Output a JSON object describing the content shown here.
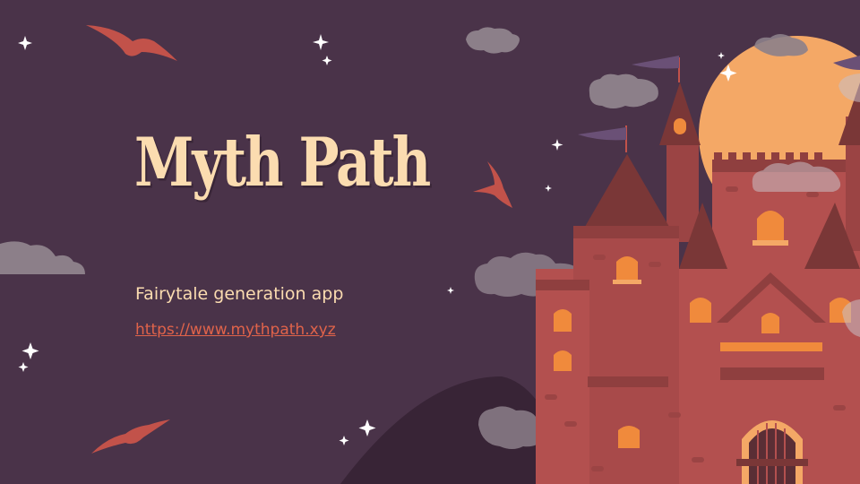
{
  "slide": {
    "title": "Myth Path",
    "subtitle": "Fairytale generation app",
    "url": "https://www.mythpath.xyz"
  },
  "colors": {
    "background": "#4a3349",
    "title": "#fbdcb0",
    "link": "#e0634a",
    "castle": "#b3504f",
    "moon": "#f4a866",
    "bird": "#c2524a"
  }
}
